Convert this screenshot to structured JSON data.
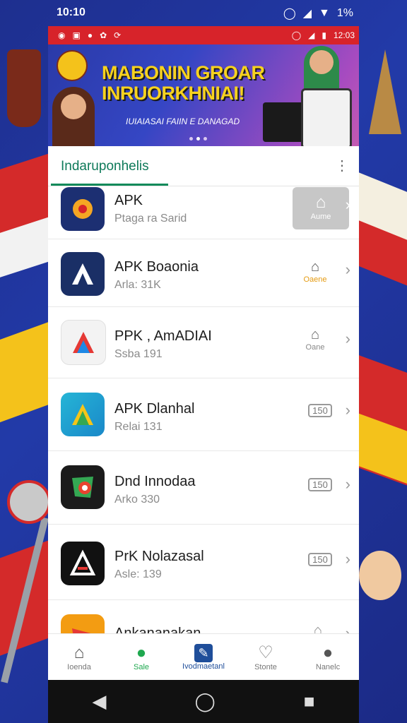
{
  "status_bar": {
    "time": "10:10",
    "battery": "1%"
  },
  "inner_status": {
    "time": "12:03"
  },
  "banner": {
    "headline": "MABONIN GROAR INRUORKHNIAI!",
    "subline": "IUIAIASAI FAIIN E DANAGAD"
  },
  "tabs": {
    "active_label": "Indaruponhelis"
  },
  "apps": [
    {
      "title": "APK",
      "subtitle": "Ptaga ra Sarid",
      "action": "Aume",
      "icon_bg": "#1c2f72",
      "icon_fg": "#f5a623"
    },
    {
      "title": "APK Boaonia",
      "subtitle": "Arla: 31K",
      "action": "Oaene",
      "icon_bg": "#1a2f66",
      "icon_fg": "#ffffff"
    },
    {
      "title": "PPK , AmADIAI",
      "subtitle": "Ssba 191",
      "action": "Oane",
      "icon_bg": "#f3f3f3",
      "icon_fg": "#e53935"
    },
    {
      "title": "APK Dlanhal",
      "subtitle": "Relai 131",
      "action": "150",
      "icon_bg": "#1aa6c9",
      "icon_fg": "#f5c518"
    },
    {
      "title": "Dnd Innodaa",
      "subtitle": "Arko 330",
      "action": "150",
      "icon_bg": "#1b1b1b",
      "icon_fg": "#e8432f"
    },
    {
      "title": "PrK Nolazasal",
      "subtitle": "Asle: 139",
      "action": "150",
      "icon_bg": "#111111",
      "icon_fg": "#e53935"
    },
    {
      "title": "Ankananakan",
      "subtitle": "",
      "action": "",
      "icon_bg": "#f39c12",
      "icon_fg": "#e53935"
    }
  ],
  "bottom_nav": [
    {
      "label": "Ioenda",
      "icon": "home-icon"
    },
    {
      "label": "Sale",
      "icon": "chat-icon"
    },
    {
      "label": "Ivodmaetanl",
      "icon": "edit-icon"
    },
    {
      "label": "Stonte",
      "icon": "heart-icon"
    },
    {
      "label": "Nanelc",
      "icon": "person-icon"
    }
  ],
  "colors": {
    "header_red": "#d7232a",
    "tab_green": "#0f7a5a"
  }
}
